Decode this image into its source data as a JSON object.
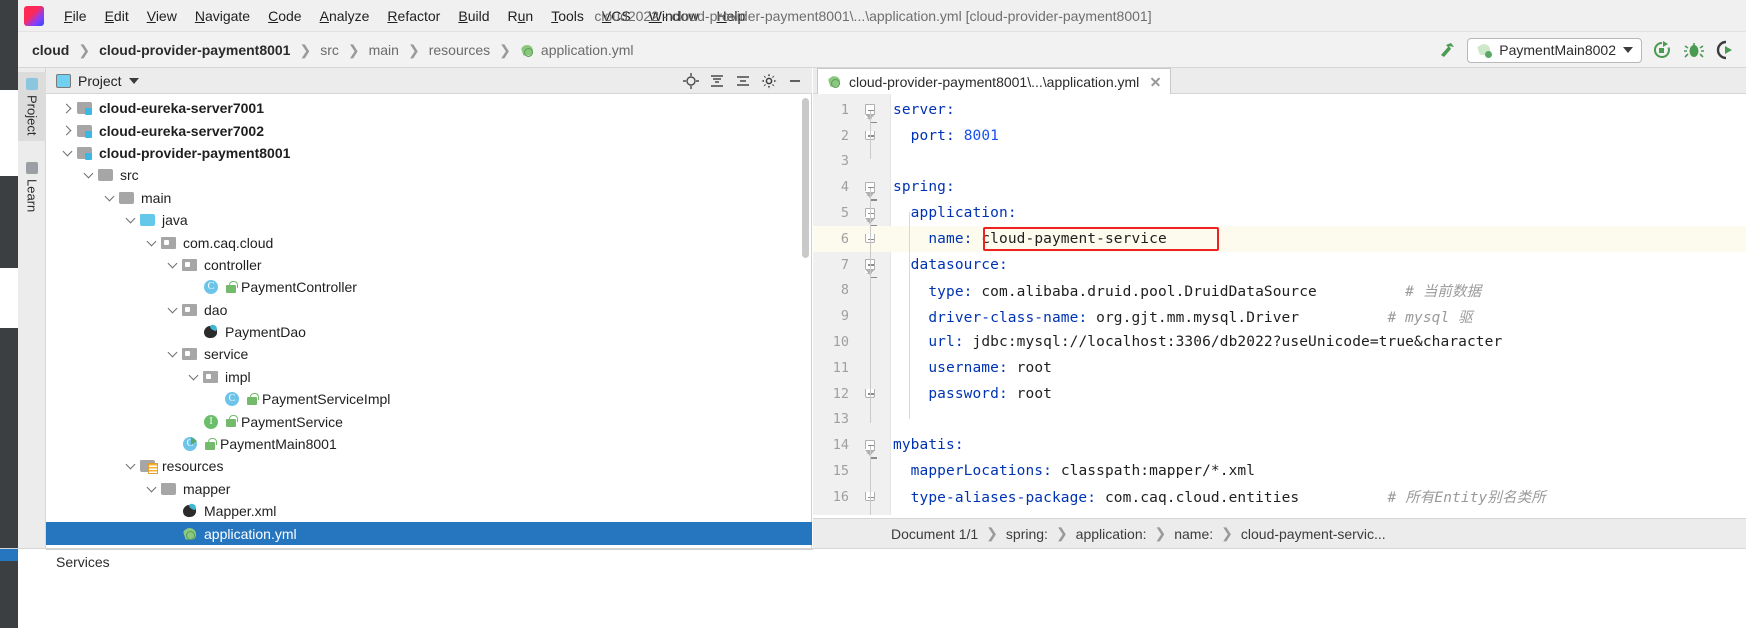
{
  "window": {
    "title": "cloud2022 - cloud-provider-payment8001\\...\\application.yml [cloud-provider-payment8001]",
    "logo_text": "IJ"
  },
  "menubar": {
    "items": [
      {
        "label": "File",
        "mnemonic": "F"
      },
      {
        "label": "Edit",
        "mnemonic": "E"
      },
      {
        "label": "View",
        "mnemonic": "V"
      },
      {
        "label": "Navigate",
        "mnemonic": "N"
      },
      {
        "label": "Code",
        "mnemonic": "C"
      },
      {
        "label": "Analyze",
        "mnemonic": "A"
      },
      {
        "label": "Refactor",
        "mnemonic": "R"
      },
      {
        "label": "Build",
        "mnemonic": "B"
      },
      {
        "label": "Run",
        "mnemonic": "u"
      },
      {
        "label": "Tools",
        "mnemonic": "T"
      },
      {
        "label": "VCS",
        "mnemonic": "V"
      },
      {
        "label": "Window",
        "mnemonic": "W"
      },
      {
        "label": "Help",
        "mnemonic": "H"
      }
    ]
  },
  "navbar": {
    "crumbs": [
      {
        "label": "cloud",
        "bold": true
      },
      {
        "label": "cloud-provider-payment8001",
        "bold": true
      },
      {
        "label": "src",
        "bold": false
      },
      {
        "label": "main",
        "bold": false
      },
      {
        "label": "resources",
        "bold": false
      },
      {
        "label": "application.yml",
        "bold": false
      }
    ],
    "separator": "❯",
    "build_icon": "hammer-icon",
    "run_config": "PaymentMain8002",
    "actions": [
      "rerun-icon",
      "debug-icon",
      "run-with-coverage-icon"
    ]
  },
  "tool_tabs": {
    "project": "Project",
    "learn": "Learn"
  },
  "project_panel": {
    "title": "Project",
    "header_icons": [
      "locate-icon",
      "collapse-icon",
      "expand-icon",
      "settings-icon",
      "hide-icon"
    ],
    "tree": [
      {
        "depth": 1,
        "label": "cloud-eureka-server7001",
        "icon": "module",
        "twisty": "right",
        "bold": true,
        "lock": false
      },
      {
        "depth": 1,
        "label": "cloud-eureka-server7002",
        "icon": "module",
        "twisty": "right",
        "bold": true,
        "lock": false
      },
      {
        "depth": 1,
        "label": "cloud-provider-payment8001",
        "icon": "module",
        "twisty": "down",
        "bold": true,
        "lock": false
      },
      {
        "depth": 2,
        "label": "src",
        "icon": "folder",
        "twisty": "down",
        "bold": false,
        "lock": false
      },
      {
        "depth": 3,
        "label": "main",
        "icon": "folder",
        "twisty": "down",
        "bold": false,
        "lock": false
      },
      {
        "depth": 4,
        "label": "java",
        "icon": "srcfolder",
        "twisty": "down",
        "bold": false,
        "lock": false
      },
      {
        "depth": 5,
        "label": "com.caq.cloud",
        "icon": "pkg",
        "twisty": "down",
        "bold": false,
        "lock": false
      },
      {
        "depth": 6,
        "label": "controller",
        "icon": "pkg",
        "twisty": "down",
        "bold": false,
        "lock": false
      },
      {
        "depth": 7,
        "label": "PaymentController",
        "icon": "cls",
        "twisty": "none",
        "bold": false,
        "lock": true
      },
      {
        "depth": 6,
        "label": "dao",
        "icon": "pkg",
        "twisty": "down",
        "bold": false,
        "lock": false
      },
      {
        "depth": 7,
        "label": "PaymentDao",
        "icon": "xmlf",
        "twisty": "none",
        "bold": false,
        "lock": false
      },
      {
        "depth": 6,
        "label": "service",
        "icon": "pkg",
        "twisty": "down",
        "bold": false,
        "lock": false
      },
      {
        "depth": 7,
        "label": "impl",
        "icon": "pkg",
        "twisty": "down",
        "bold": false,
        "lock": false
      },
      {
        "depth": 8,
        "label": "PaymentServiceImpl",
        "icon": "cls",
        "twisty": "none",
        "bold": false,
        "lock": true
      },
      {
        "depth": 7,
        "label": "PaymentService",
        "icon": "iface",
        "twisty": "none",
        "bold": false,
        "lock": true
      },
      {
        "depth": 6,
        "label": "PaymentMain8001",
        "icon": "mainc",
        "twisty": "none",
        "bold": false,
        "lock": true
      },
      {
        "depth": 4,
        "label": "resources",
        "icon": "resfolder",
        "twisty": "down",
        "bold": false,
        "lock": false
      },
      {
        "depth": 5,
        "label": "mapper",
        "icon": "folder",
        "twisty": "down",
        "bold": false,
        "lock": false
      },
      {
        "depth": 6,
        "label": "Mapper.xml",
        "icon": "xmlf",
        "twisty": "none",
        "bold": false,
        "lock": false
      },
      {
        "depth": 6,
        "label": "application.yml",
        "icon": "ymlf",
        "twisty": "none",
        "bold": false,
        "lock": false,
        "selected": true
      }
    ]
  },
  "editor": {
    "tab_label": "cloud-provider-payment8001\\...\\application.yml",
    "tab_icon": "yaml-file-icon",
    "highlight_line": 6,
    "red_box_text": "cloud-payment-service",
    "lines": [
      {
        "no": 1,
        "fold": "open",
        "text": "server:",
        "type": "key"
      },
      {
        "no": 2,
        "fold": "close",
        "text": "  port: 8001",
        "type": "kv-num"
      },
      {
        "no": 3,
        "fold": "none",
        "text": "",
        "type": "blank"
      },
      {
        "no": 4,
        "fold": "open",
        "text": "spring:",
        "type": "key"
      },
      {
        "no": 5,
        "fold": "open",
        "text": "  application:",
        "type": "key"
      },
      {
        "no": 6,
        "fold": "close",
        "text": "    name: cloud-payment-service",
        "type": "kv"
      },
      {
        "no": 7,
        "fold": "open",
        "text": "  datasource:",
        "type": "key"
      },
      {
        "no": 8,
        "fold": "none",
        "text": "    type: com.alibaba.druid.pool.DruidDataSource",
        "type": "kv",
        "comment": "# 当前数据"
      },
      {
        "no": 9,
        "fold": "none",
        "text": "    driver-class-name: org.gjt.mm.mysql.Driver",
        "type": "kv",
        "comment": "# mysql 驱"
      },
      {
        "no": 10,
        "fold": "none",
        "text": "    url: jdbc:mysql://localhost:3306/db2022?useUnicode=true&character",
        "type": "kv"
      },
      {
        "no": 11,
        "fold": "none",
        "text": "    username: root",
        "type": "kv"
      },
      {
        "no": 12,
        "fold": "close",
        "text": "    password: root",
        "type": "kv"
      },
      {
        "no": 13,
        "fold": "none",
        "text": "",
        "type": "blank"
      },
      {
        "no": 14,
        "fold": "open",
        "text": "mybatis:",
        "type": "key"
      },
      {
        "no": 15,
        "fold": "none",
        "text": "  mapperLocations: classpath:mapper/*.xml",
        "type": "kv"
      },
      {
        "no": 16,
        "fold": "close",
        "text": "  type-aliases-package: com.caq.cloud.entities",
        "type": "kv",
        "comment": "# 所有Entity别名类所"
      }
    ]
  },
  "bottom_breadcrumb": {
    "items": [
      "Document 1/1",
      "spring:",
      "application:",
      "name:",
      "cloud-payment-servic..."
    ],
    "separator": "❯"
  },
  "statusbar": {
    "services_label": "Services"
  },
  "colors": {
    "selection": "#2675bf",
    "red_box": "#ee2222",
    "key": "#0033b3",
    "number": "#1750eb",
    "comment": "#9a9a9a",
    "highlight_row": "#fcfbee"
  }
}
